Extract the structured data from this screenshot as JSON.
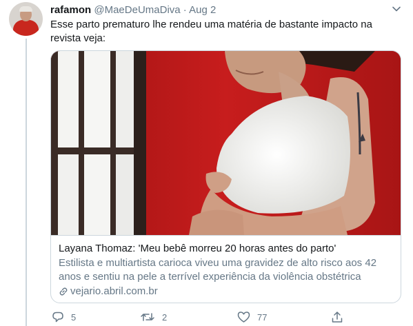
{
  "tweet": {
    "author_name": "rafamon",
    "handle": "@MaeDeUmaDiva",
    "separator": "·",
    "date": "Aug 2",
    "text": "Esse parto prematuro lhe rendeu uma matéria de bastante impacto na revista veja:",
    "avatar_icon": "profile-avatar",
    "more_icon": "chevron-down-icon"
  },
  "card": {
    "image_icon": "pregnant-woman-photo",
    "title": "Layana Thomaz: 'Meu bebê morreu 20 horas antes do parto'",
    "description": "Estilista e multiartista carioca viveu uma gravidez de alto risco aos 42 anos e sentiu na pele a terrível experiência da violência obstétrica",
    "domain": "vejario.abril.com.br",
    "link_icon": "link-icon"
  },
  "actions": {
    "reply_count": "5",
    "retweet_count": "2",
    "like_count": "77",
    "reply_icon": "reply-icon",
    "retweet_icon": "retweet-icon",
    "like_icon": "heart-icon",
    "share_icon": "share-icon"
  },
  "colors": {
    "text": "#14171a",
    "muted": "#657786",
    "border": "#ccd6dd"
  }
}
